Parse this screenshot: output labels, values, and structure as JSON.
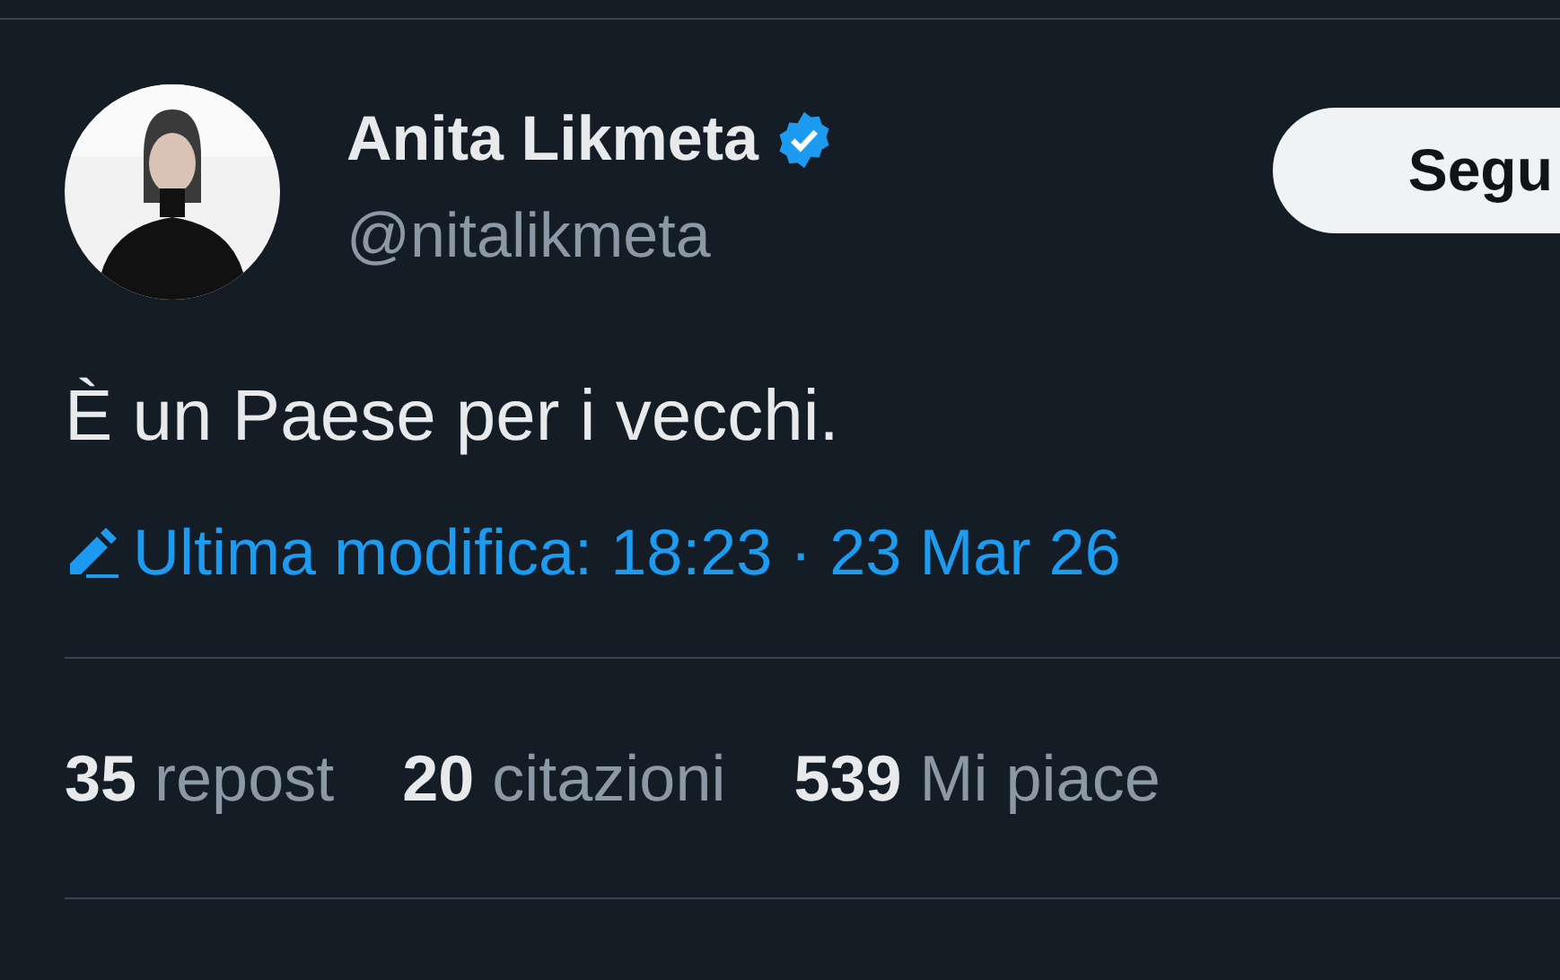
{
  "author": {
    "name": "Anita Likmeta",
    "verified": true,
    "handle": "@nitalikmeta"
  },
  "follow_button": {
    "label": "Segu"
  },
  "text": "È un Paese per i vecchi.",
  "edit_info": "Ultima modifica: 18:23 · 23 Mar 26",
  "stats": [
    {
      "count": "35",
      "label": "repost"
    },
    {
      "count": "20",
      "label": "citazioni"
    },
    {
      "count": "539",
      "label": "Mi piace"
    }
  ]
}
